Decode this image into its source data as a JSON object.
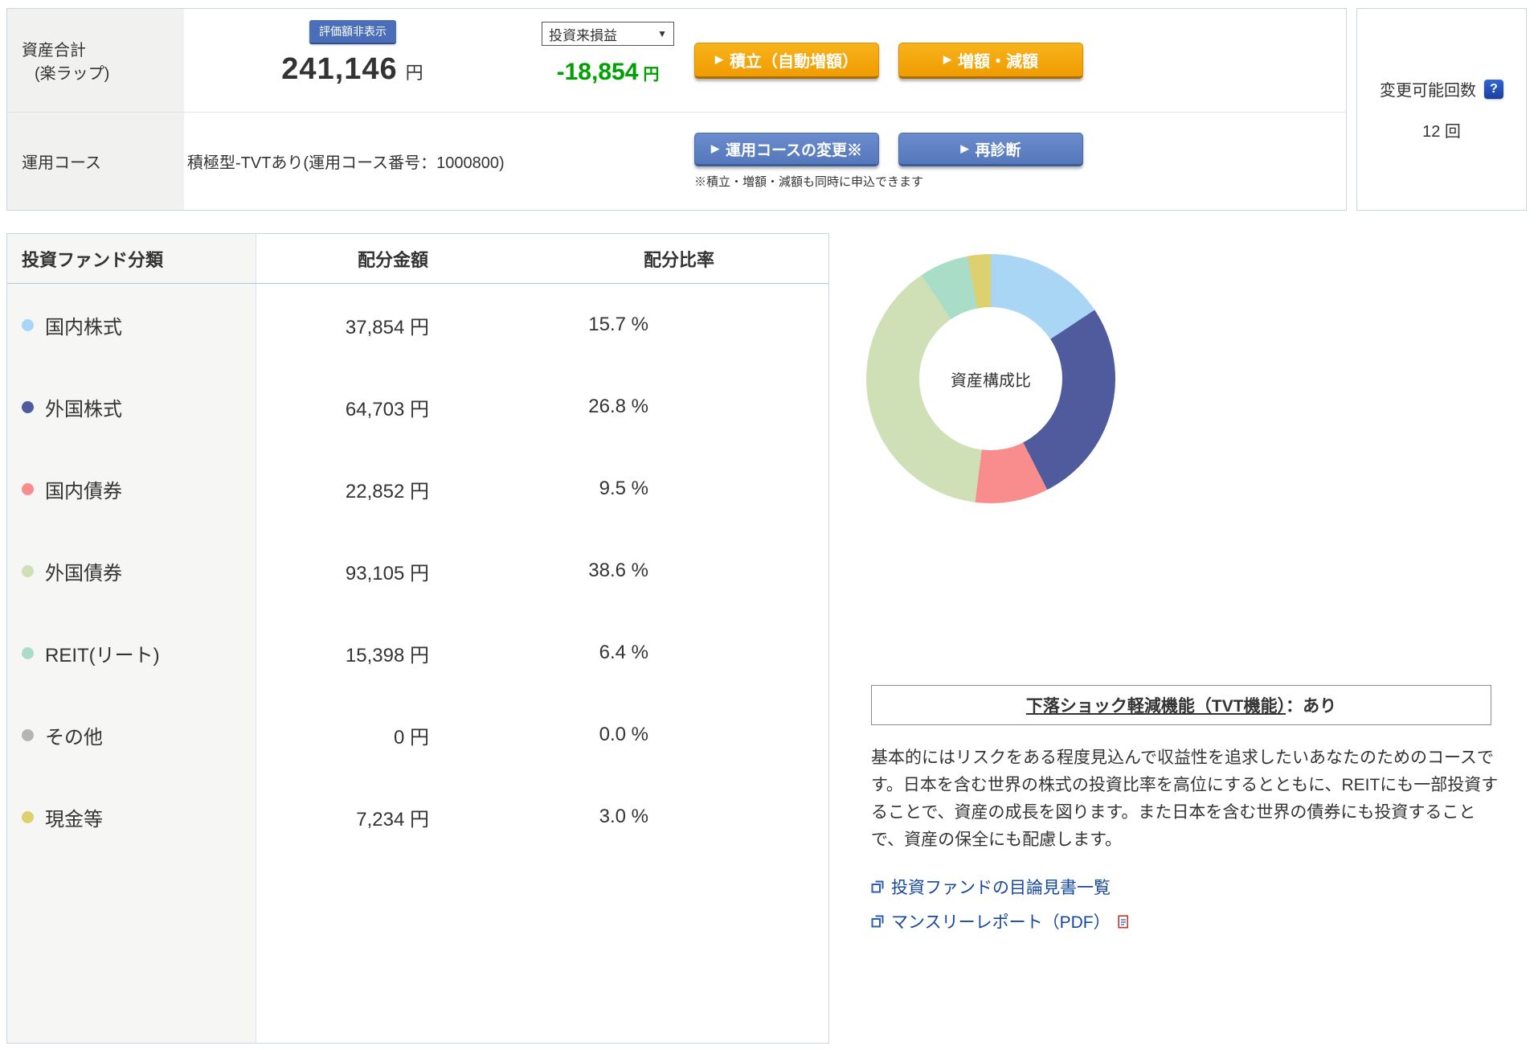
{
  "header": {
    "asset_label_line1": "資産合計",
    "asset_label_line2": "(楽ラップ)",
    "hide_button": "評価額非表示",
    "total_amount": "241,146",
    "total_unit": "円",
    "pl_select": "投資来損益",
    "pl_select_caret": "▼",
    "pl_value": "-18,854",
    "pl_unit": "円",
    "btn_marker": "▶",
    "btn_tsumitate": "積立（自動増額）",
    "btn_zougaku": "増額・減額",
    "course_label": "運用コース",
    "course_value": "積極型-TVTあり(運用コース番号：1000800)",
    "btn_course_change": "運用コースの変更※",
    "btn_rediagnosis": "再診断",
    "note": "※積立・増額・減額も同時に申込できます",
    "change_label": "変更可能回数",
    "change_help": "?",
    "change_value": "12 回"
  },
  "table": {
    "headers": [
      "投資ファンド分類",
      "配分金額",
      "配分比率"
    ],
    "amount_unit": "円",
    "ratio_unit": "%",
    "rows": [
      {
        "label": "国内株式",
        "color": "#a9d6f5",
        "amount": "37,854",
        "ratio": "15.7"
      },
      {
        "label": "外国株式",
        "color": "#4f5b9c",
        "amount": "64,703",
        "ratio": "26.8"
      },
      {
        "label": "国内債券",
        "color": "#f98d8d",
        "amount": "22,852",
        "ratio": "9.5"
      },
      {
        "label": "外国債券",
        "color": "#cfdfb6",
        "amount": "93,105",
        "ratio": "38.6"
      },
      {
        "label": "REIT(リート)",
        "color": "#aaddc8",
        "amount": "15,398",
        "ratio": "6.4"
      },
      {
        "label": "その他",
        "color": "#b5b5b5",
        "amount": "0",
        "ratio": "0.0"
      },
      {
        "label": "現金等",
        "color": "#ddd06e",
        "amount": "7,234",
        "ratio": "3.0"
      }
    ]
  },
  "chart_data": {
    "type": "pie",
    "donut": true,
    "title": "資産構成比",
    "center_label": "資産構成比",
    "categories": [
      "国内株式",
      "外国株式",
      "国内債券",
      "外国債券",
      "REIT(リート)",
      "その他",
      "現金等"
    ],
    "values": [
      15.7,
      26.8,
      9.5,
      38.6,
      6.4,
      0.0,
      3.0
    ],
    "colors": [
      "#a9d6f5",
      "#4f5b9c",
      "#f98d8d",
      "#cfdfb6",
      "#aaddc8",
      "#b5b5b5",
      "#ddd06e"
    ],
    "legend_position": "none",
    "start_angle_deg": 0,
    "direction": "clockwise"
  },
  "tvt": {
    "underlined": "下落ショック軽減機能（TVT機能）",
    "suffix": "：あり"
  },
  "description": "基本的にはリスクをある程度見込んで収益性を追求したいあなたのためのコースです。日本を含む世界の株式の投資比率を高位にするとともに、REITにも一部投資することで、資産の成長を図ります。また日本を含む世界の債券にも投資することで、資産の保全にも配慮します。",
  "links": {
    "prospectus": "投資ファンドの目論見書一覧",
    "monthly_report": "マンスリーレポート（PDF）"
  }
}
